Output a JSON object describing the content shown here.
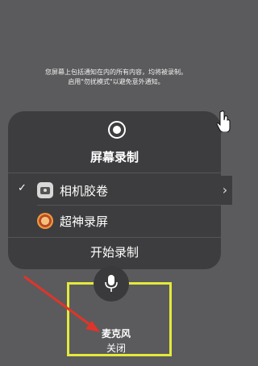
{
  "notice": {
    "line1": "您屏幕上包括通知在内的所有内容，均将被录制。",
    "line2": "启用\"勿扰模式\"以避免意外通知。"
  },
  "panel": {
    "title": "屏幕录制",
    "record_icon": "record-circle-icon",
    "options": [
      {
        "label": "相机胶卷",
        "selected": true,
        "check": "✓",
        "icon": "camera-roll-icon"
      },
      {
        "label": "超神录屏",
        "selected": false,
        "check": "",
        "icon": "chaoshen-recorder-icon"
      }
    ],
    "start_label": "开始录制"
  },
  "mic": {
    "label": "麦克风",
    "status": "关闭",
    "icon": "microphone-icon"
  },
  "colors": {
    "background": "#5b5b5d",
    "panel": "#3d3d3f",
    "highlight_box": "#e4ea3a",
    "annotation_arrow": "#e0342a"
  }
}
